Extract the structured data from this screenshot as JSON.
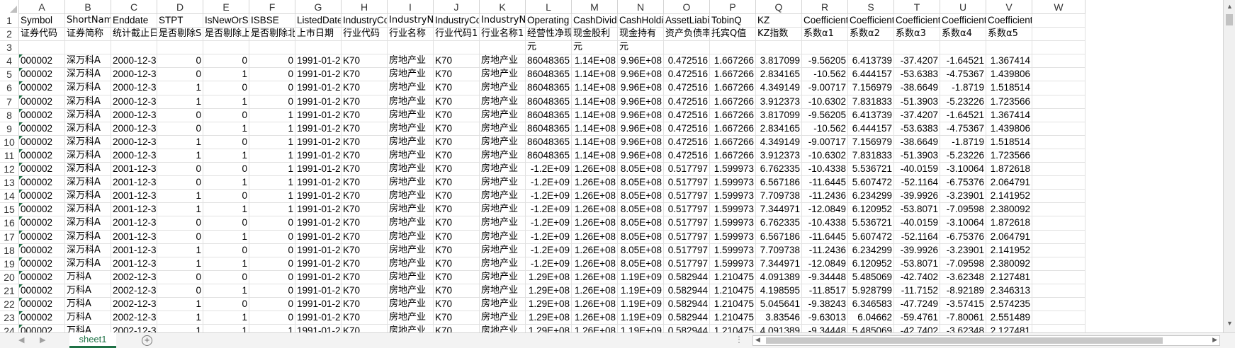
{
  "columns": [
    "A",
    "B",
    "C",
    "D",
    "E",
    "F",
    "G",
    "H",
    "I",
    "J",
    "K",
    "L",
    "M",
    "N",
    "O",
    "P",
    "Q",
    "R",
    "S",
    "T",
    "U",
    "V",
    "W"
  ],
  "row_numbers": [
    "1",
    "2",
    "3",
    "4",
    "5",
    "6",
    "7",
    "8",
    "9",
    "10",
    "11",
    "12",
    "13",
    "14",
    "15",
    "16",
    "17",
    "18",
    "19",
    "20",
    "21",
    "22",
    "23",
    "24"
  ],
  "rows": [
    [
      "Symbol",
      "ShortName",
      "Enddate",
      "STPT",
      "IsNewOrSu",
      "ISBSE",
      "ListedDate",
      "IndustryCo",
      "IndustryNa",
      "IndustryCo",
      "IndustryNa",
      "Operating",
      "CashDivide",
      "CashHoldi",
      "AssetLiabil",
      "TobinQ",
      "KZ",
      "Coefficient",
      "Coefficient",
      "Coefficient",
      "Coefficient",
      "Coefficient5",
      ""
    ],
    [
      "证券代码",
      "证券简称",
      "统计截止日",
      "是否剔除S",
      "是否剔除上",
      "是否剔除北",
      "上市日期",
      "行业代码",
      "行业名称",
      "行业代码1",
      "行业名称1",
      "经营性净现",
      "现金股利",
      "现金持有",
      "资产负债率",
      "托宾Q值",
      "KZ指数",
      "系数α1",
      "系数α2",
      "系数α3",
      "系数α4",
      "系数α5",
      ""
    ],
    [
      "",
      "",
      "",
      "",
      "",
      "",
      "",
      "",
      "",
      "",
      "",
      "元",
      "元",
      "元",
      "",
      "",
      "",
      "",
      "",
      "",
      "",
      "",
      ""
    ],
    [
      "000002",
      "深万科A",
      "2000-12-3",
      "0",
      "0",
      "0",
      "1991-01-2",
      "K70",
      "房地产业",
      "K70",
      "房地产业",
      "86048365",
      "1.14E+08",
      "9.96E+08",
      "0.472516",
      "1.667266",
      "3.817099",
      "-9.56205",
      "6.413739",
      "-37.4207",
      "-1.64521",
      "1.367414",
      ""
    ],
    [
      "000002",
      "深万科A",
      "2000-12-3",
      "0",
      "1",
      "0",
      "1991-01-2",
      "K70",
      "房地产业",
      "K70",
      "房地产业",
      "86048365",
      "1.14E+08",
      "9.96E+08",
      "0.472516",
      "1.667266",
      "2.834165",
      "-10.562",
      "6.444157",
      "-53.6383",
      "-4.75367",
      "1.439806",
      ""
    ],
    [
      "000002",
      "深万科A",
      "2000-12-3",
      "1",
      "0",
      "0",
      "1991-01-2",
      "K70",
      "房地产业",
      "K70",
      "房地产业",
      "86048365",
      "1.14E+08",
      "9.96E+08",
      "0.472516",
      "1.667266",
      "4.349149",
      "-9.00717",
      "7.156979",
      "-38.6649",
      "-1.8719",
      "1.518514",
      ""
    ],
    [
      "000002",
      "深万科A",
      "2000-12-3",
      "1",
      "1",
      "0",
      "1991-01-2",
      "K70",
      "房地产业",
      "K70",
      "房地产业",
      "86048365",
      "1.14E+08",
      "9.96E+08",
      "0.472516",
      "1.667266",
      "3.912373",
      "-10.6302",
      "7.831833",
      "-51.3903",
      "-5.23226",
      "1.723566",
      ""
    ],
    [
      "000002",
      "深万科A",
      "2000-12-3",
      "0",
      "0",
      "1",
      "1991-01-2",
      "K70",
      "房地产业",
      "K70",
      "房地产业",
      "86048365",
      "1.14E+08",
      "9.96E+08",
      "0.472516",
      "1.667266",
      "3.817099",
      "-9.56205",
      "6.413739",
      "-37.4207",
      "-1.64521",
      "1.367414",
      ""
    ],
    [
      "000002",
      "深万科A",
      "2000-12-3",
      "0",
      "1",
      "1",
      "1991-01-2",
      "K70",
      "房地产业",
      "K70",
      "房地产业",
      "86048365",
      "1.14E+08",
      "9.96E+08",
      "0.472516",
      "1.667266",
      "2.834165",
      "-10.562",
      "6.444157",
      "-53.6383",
      "-4.75367",
      "1.439806",
      ""
    ],
    [
      "000002",
      "深万科A",
      "2000-12-3",
      "1",
      "0",
      "1",
      "1991-01-2",
      "K70",
      "房地产业",
      "K70",
      "房地产业",
      "86048365",
      "1.14E+08",
      "9.96E+08",
      "0.472516",
      "1.667266",
      "4.349149",
      "-9.00717",
      "7.156979",
      "-38.6649",
      "-1.8719",
      "1.518514",
      ""
    ],
    [
      "000002",
      "深万科A",
      "2000-12-3",
      "1",
      "1",
      "1",
      "1991-01-2",
      "K70",
      "房地产业",
      "K70",
      "房地产业",
      "86048365",
      "1.14E+08",
      "9.96E+08",
      "0.472516",
      "1.667266",
      "3.912373",
      "-10.6302",
      "7.831833",
      "-51.3903",
      "-5.23226",
      "1.723566",
      ""
    ],
    [
      "000002",
      "深万科A",
      "2001-12-3",
      "0",
      "0",
      "1",
      "1991-01-2",
      "K70",
      "房地产业",
      "K70",
      "房地产业",
      "-1.2E+09",
      "1.26E+08",
      "8.05E+08",
      "0.517797",
      "1.599973",
      "6.762335",
      "-10.4338",
      "5.536721",
      "-40.0159",
      "-3.10064",
      "1.872618",
      ""
    ],
    [
      "000002",
      "深万科A",
      "2001-12-3",
      "0",
      "1",
      "1",
      "1991-01-2",
      "K70",
      "房地产业",
      "K70",
      "房地产业",
      "-1.2E+09",
      "1.26E+08",
      "8.05E+08",
      "0.517797",
      "1.599973",
      "6.567186",
      "-11.6445",
      "5.607472",
      "-52.1164",
      "-6.75376",
      "2.064791",
      ""
    ],
    [
      "000002",
      "深万科A",
      "2001-12-3",
      "1",
      "0",
      "1",
      "1991-01-2",
      "K70",
      "房地产业",
      "K70",
      "房地产业",
      "-1.2E+09",
      "1.26E+08",
      "8.05E+08",
      "0.517797",
      "1.599973",
      "7.709738",
      "-11.2436",
      "6.234299",
      "-39.9926",
      "-3.23901",
      "2.141952",
      ""
    ],
    [
      "000002",
      "深万科A",
      "2001-12-3",
      "1",
      "1",
      "1",
      "1991-01-2",
      "K70",
      "房地产业",
      "K70",
      "房地产业",
      "-1.2E+09",
      "1.26E+08",
      "8.05E+08",
      "0.517797",
      "1.599973",
      "7.344971",
      "-12.0849",
      "6.120952",
      "-53.8071",
      "-7.09598",
      "2.380092",
      ""
    ],
    [
      "000002",
      "深万科A",
      "2001-12-3",
      "0",
      "0",
      "0",
      "1991-01-2",
      "K70",
      "房地产业",
      "K70",
      "房地产业",
      "-1.2E+09",
      "1.26E+08",
      "8.05E+08",
      "0.517797",
      "1.599973",
      "6.762335",
      "-10.4338",
      "5.536721",
      "-40.0159",
      "-3.10064",
      "1.872618",
      ""
    ],
    [
      "000002",
      "深万科A",
      "2001-12-3",
      "0",
      "1",
      "0",
      "1991-01-2",
      "K70",
      "房地产业",
      "K70",
      "房地产业",
      "-1.2E+09",
      "1.26E+08",
      "8.05E+08",
      "0.517797",
      "1.599973",
      "6.567186",
      "-11.6445",
      "5.607472",
      "-52.1164",
      "-6.75376",
      "2.064791",
      ""
    ],
    [
      "000002",
      "深万科A",
      "2001-12-3",
      "1",
      "0",
      "0",
      "1991-01-2",
      "K70",
      "房地产业",
      "K70",
      "房地产业",
      "-1.2E+09",
      "1.26E+08",
      "8.05E+08",
      "0.517797",
      "1.599973",
      "7.709738",
      "-11.2436",
      "6.234299",
      "-39.9926",
      "-3.23901",
      "2.141952",
      ""
    ],
    [
      "000002",
      "深万科A",
      "2001-12-3",
      "1",
      "1",
      "0",
      "1991-01-2",
      "K70",
      "房地产业",
      "K70",
      "房地产业",
      "-1.2E+09",
      "1.26E+08",
      "8.05E+08",
      "0.517797",
      "1.599973",
      "7.344971",
      "-12.0849",
      "6.120952",
      "-53.8071",
      "-7.09598",
      "2.380092",
      ""
    ],
    [
      "000002",
      "万科A",
      "2002-12-3",
      "0",
      "0",
      "0",
      "1991-01-2",
      "K70",
      "房地产业",
      "K70",
      "房地产业",
      "1.29E+08",
      "1.26E+08",
      "1.19E+09",
      "0.582944",
      "1.210475",
      "4.091389",
      "-9.34448",
      "5.485069",
      "-42.7402",
      "-3.62348",
      "2.127481",
      ""
    ],
    [
      "000002",
      "万科A",
      "2002-12-3",
      "0",
      "1",
      "0",
      "1991-01-2",
      "K70",
      "房地产业",
      "K70",
      "房地产业",
      "1.29E+08",
      "1.26E+08",
      "1.19E+09",
      "0.582944",
      "1.210475",
      "4.198595",
      "-11.8517",
      "5.928799",
      "-11.7152",
      "-8.92189",
      "2.346313",
      ""
    ],
    [
      "000002",
      "万科A",
      "2002-12-3",
      "1",
      "0",
      "0",
      "1991-01-2",
      "K70",
      "房地产业",
      "K70",
      "房地产业",
      "1.29E+08",
      "1.26E+08",
      "1.19E+09",
      "0.582944",
      "1.210475",
      "5.045641",
      "-9.38243",
      "6.346583",
      "-47.7249",
      "-3.57415",
      "2.574235",
      ""
    ],
    [
      "000002",
      "万科A",
      "2002-12-3",
      "1",
      "1",
      "0",
      "1991-01-2",
      "K70",
      "房地产业",
      "K70",
      "房地产业",
      "1.29E+08",
      "1.26E+08",
      "1.19E+09",
      "0.582944",
      "1.210475",
      "3.83546",
      "-9.63013",
      "6.04662",
      "-59.4761",
      "-7.80061",
      "2.551489",
      ""
    ],
    [
      "000002",
      "万科A",
      "2002-12-3",
      "1",
      "1",
      "1",
      "1991-01-2",
      "K70",
      "房地产业",
      "K70",
      "房地产业",
      "1.29E+08",
      "1.26E+08",
      "1.19E+09",
      "0.582944",
      "1.210475",
      "4.091389",
      "-9.34448",
      "5.485069",
      "-42.7402",
      "-3.62348",
      "2.127481",
      ""
    ]
  ],
  "sheet_tab": "sheet1",
  "add_sheet_icon": "+",
  "scroll_dots": "⋮"
}
